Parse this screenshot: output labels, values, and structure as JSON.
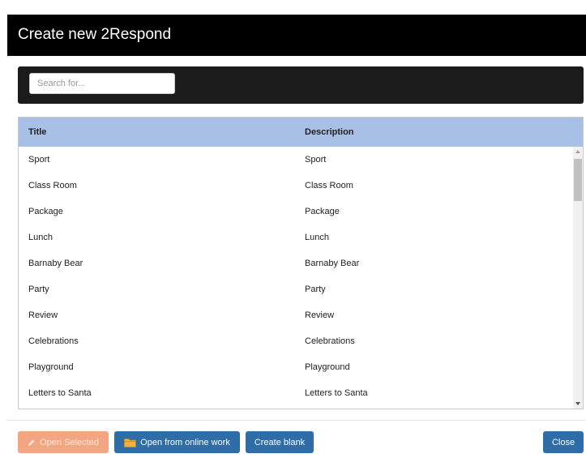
{
  "dialog": {
    "title": "Create new 2Respond"
  },
  "search": {
    "placeholder": "Search for..."
  },
  "table": {
    "headers": {
      "title": "Title",
      "description": "Description"
    },
    "rows": [
      {
        "title": "Sport",
        "description": "Sport"
      },
      {
        "title": "Class Room",
        "description": "Class Room"
      },
      {
        "title": "Package",
        "description": "Package"
      },
      {
        "title": "Lunch",
        "description": "Lunch"
      },
      {
        "title": "Barnaby Bear",
        "description": "Barnaby Bear"
      },
      {
        "title": "Party",
        "description": "Party"
      },
      {
        "title": "Review",
        "description": "Review"
      },
      {
        "title": "Celebrations",
        "description": "Celebrations"
      },
      {
        "title": "Playground",
        "description": "Playground"
      },
      {
        "title": "Letters to Santa",
        "description": "Letters to Santa"
      }
    ]
  },
  "footer": {
    "open_selected_label": "Open Selected",
    "open_online_label": "Open from online work",
    "create_blank_label": "Create blank",
    "close_label": "Close"
  },
  "icons": {
    "open_selected": "pencil-icon",
    "open_online": "folder-icon"
  },
  "colors": {
    "header_background": "#000000",
    "search_bar_background": "#1b1b1b",
    "table_header_background": "#a8bfe6",
    "primary_button": "#2e6da8",
    "disabled_button": "#f4a581"
  }
}
